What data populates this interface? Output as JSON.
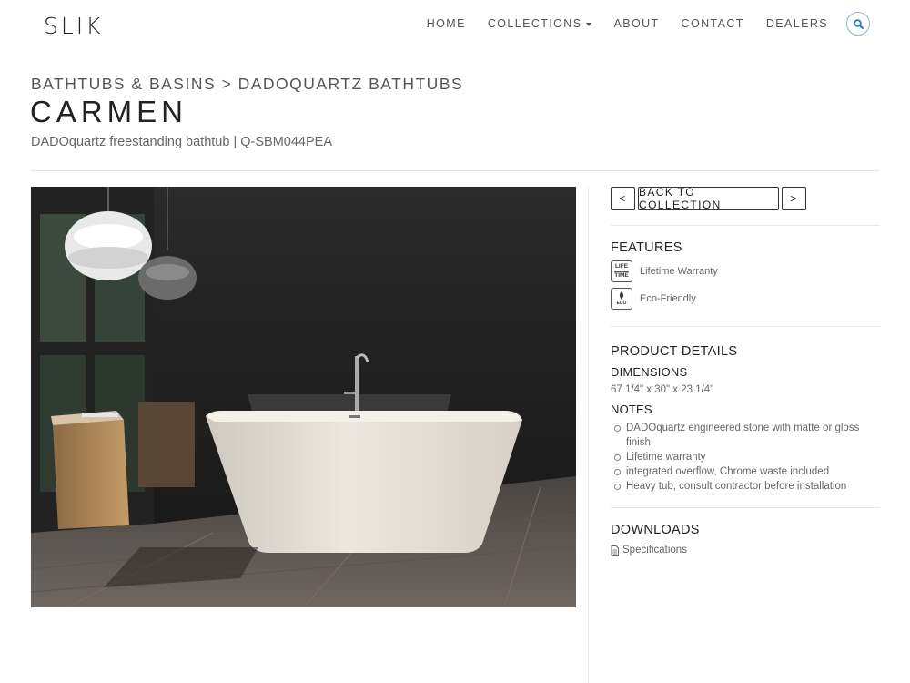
{
  "header": {
    "logo": "SLIK",
    "nav": [
      {
        "label": "HOME"
      },
      {
        "label": "COLLECTIONS"
      },
      {
        "label": "ABOUT"
      },
      {
        "label": "CONTACT"
      },
      {
        "label": "DEALERS"
      }
    ],
    "search_icon": "search-icon",
    "accent_color": "#2a7ab8"
  },
  "page": {
    "breadcrumb": "BATHTUBS & BASINS > DADOQUARTZ BATHTUBS",
    "title": "CARMEN",
    "subtitle": "DADOquartz freestanding bathtub | Q-SBM044PEA"
  },
  "sidebar": {
    "prev_label": "<",
    "back_label": "BACK TO COLLECTION",
    "next_label": ">",
    "features_heading": "FEATURES",
    "features": [
      {
        "icon": "lifetime-icon",
        "icon_text_1": "LIFE",
        "icon_text_2": "TIME",
        "label": "Lifetime Warranty"
      },
      {
        "icon": "eco-icon",
        "icon_text_1": "ECO",
        "label": "Eco-Friendly"
      }
    ],
    "details_heading": "PRODUCT DETAILS",
    "dimensions_heading": "DIMENSIONS",
    "dimensions": "67 1/4\" x 30\" x 23 1/4\"",
    "notes_heading": "NOTES",
    "notes": [
      "DADOquartz engineered stone with matte or gloss finish",
      "Lifetime warranty",
      "integrated overflow, Chrome waste included",
      "Heavy tub, consult contractor before installation"
    ],
    "downloads_heading": "DOWNLOADS",
    "downloads": [
      {
        "icon": "document-icon",
        "label": "Specifications"
      }
    ]
  }
}
